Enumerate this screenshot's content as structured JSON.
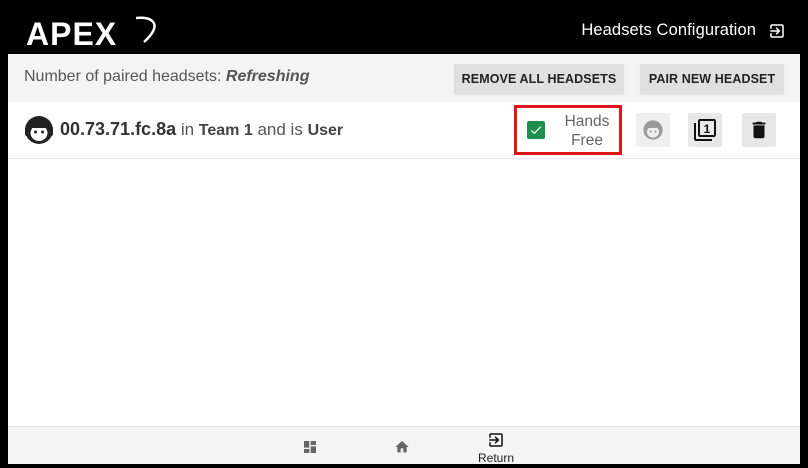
{
  "header": {
    "logo_text": "APEX",
    "title": "Headsets Configuration",
    "exit_icon": "exit-to-app-icon"
  },
  "infobar": {
    "paired_label": "Number of paired headsets: ",
    "paired_status": "Refreshing",
    "remove_all_label": "REMOVE ALL HEADSETS",
    "pair_new_label": "PAIR NEW HEADSET"
  },
  "headsets": [
    {
      "address": "00.73.71.fc.8a",
      "in_word": " in ",
      "team": "Team 1",
      "and_word": " and is ",
      "role": "User",
      "hands_free_line1": "Hands",
      "hands_free_line2": "Free",
      "hands_free_checked": true,
      "team_number": "1"
    }
  ],
  "bottombar": {
    "return_label": "Return"
  },
  "colors": {
    "header_bg": "#000000",
    "checkbox_green": "#1f8f4c",
    "highlight_red": "#e0161b"
  }
}
